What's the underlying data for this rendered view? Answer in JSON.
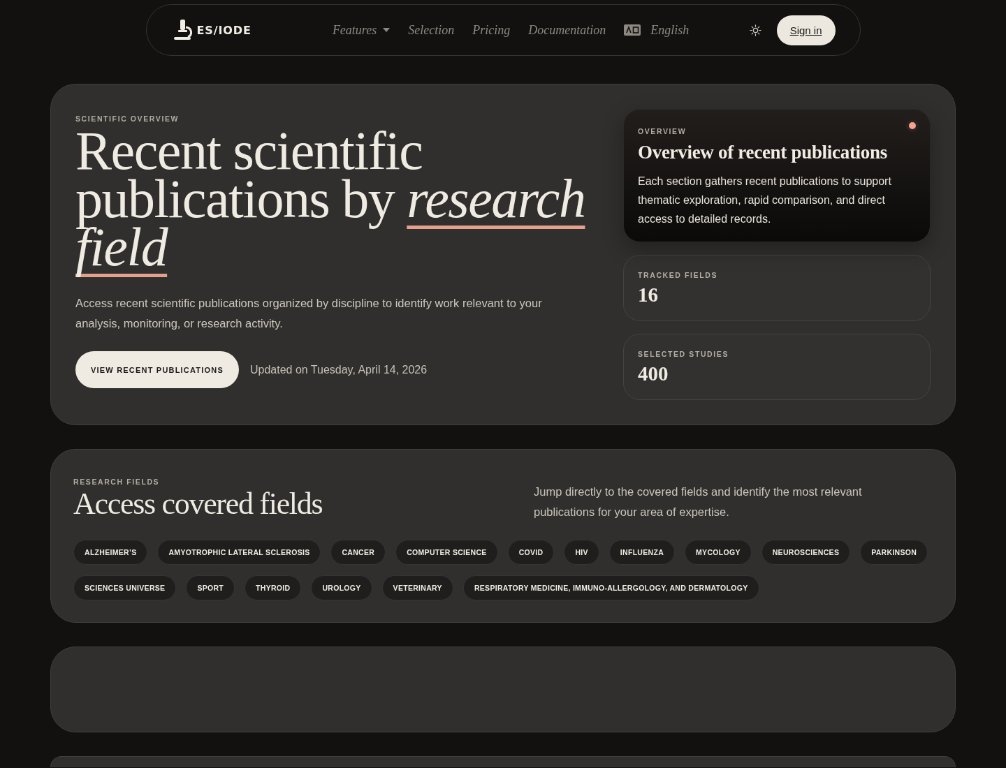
{
  "nav": {
    "logo_text": "ES/IODE",
    "links": [
      {
        "label": "Features",
        "kind": "dropdown"
      },
      {
        "label": "Selection",
        "kind": "link"
      },
      {
        "label": "Pricing",
        "kind": "link"
      },
      {
        "label": "Documentation",
        "kind": "link"
      }
    ],
    "language": "English",
    "sign_in": "Sign in"
  },
  "hero": {
    "eyebrow": "SCIENTIFIC OVERVIEW",
    "title": "Recent scientific publications by *research field*",
    "lead": "Access recent scientific publications organized by discipline to identify work relevant to your analysis, monitoring, or research activity.",
    "cta": "VIEW RECENT PUBLICATIONS",
    "updated": "Updated on Tuesday, April 14, 2026",
    "overview": {
      "eyebrow": "OVERVIEW",
      "title": "Overview of recent publications",
      "body": "Each section gathers recent publications to support thematic exploration, rapid comparison, and direct access to detailed records."
    },
    "stats": [
      {
        "label": "TRACKED FIELDS",
        "value": "16"
      },
      {
        "label": "SELECTED STUDIES",
        "value": "400"
      }
    ]
  },
  "fields_section": {
    "eyebrow": "RESEARCH FIELDS",
    "title": "Access covered fields",
    "description": "Jump directly to the covered fields and identify the most relevant publications for your area of expertise.",
    "tags": [
      "ALZHEIMER’S",
      "AMYOTROPHIC LATERAL SCLEROSIS",
      "CANCER",
      "COMPUTER SCIENCE",
      "COVID",
      "HIV",
      "INFLUENZA",
      "MYCOLOGY",
      "NEUROSCIENCES",
      "PARKINSON",
      "SCIENCES UNIVERSE",
      "SPORT",
      "THYROID",
      "UROLOGY",
      "VETERINARY",
      "RESPIRATORY MEDICINE, IMMUNO-ALLERGOLOGY, AND DERMATOLOGY"
    ]
  }
}
